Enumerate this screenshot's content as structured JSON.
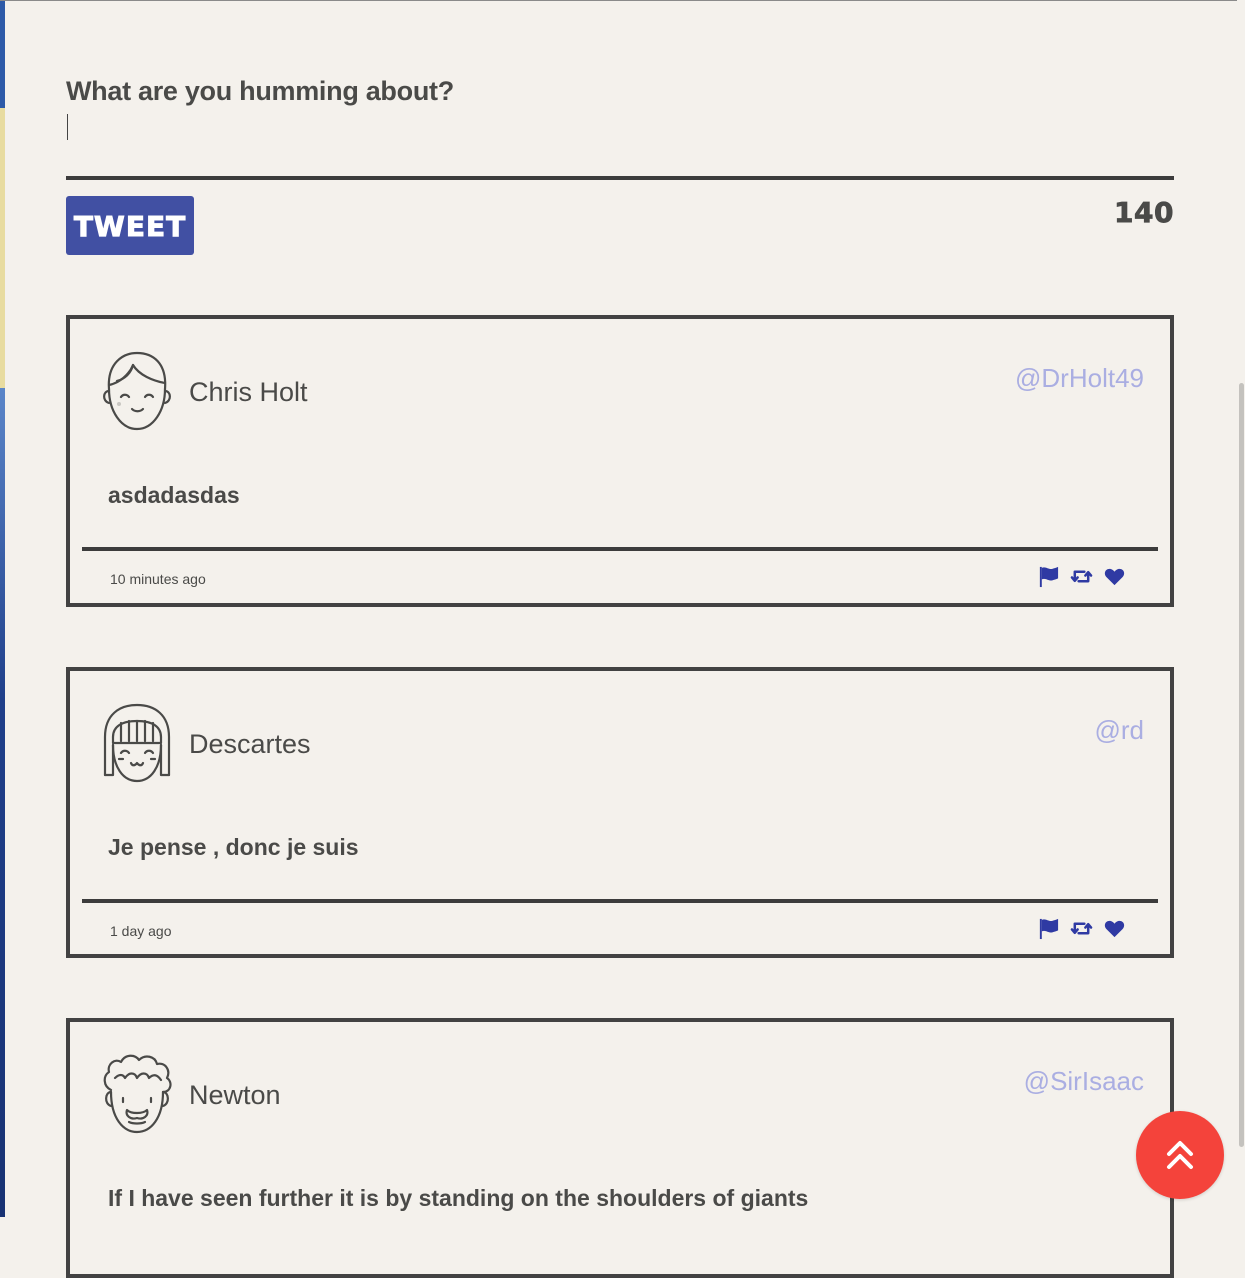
{
  "composer": {
    "label": "What are you humming about?",
    "input_value": "",
    "tweet_button_label": "TWEET",
    "char_count": "140"
  },
  "tweets": [
    {
      "name": "Chris Holt",
      "handle": "@DrHolt49",
      "body": "asdadasdas",
      "time": "10 minutes ago",
      "avatar": "boy-face-icon"
    },
    {
      "name": "Descartes",
      "handle": "@rd",
      "body": "Je pense , donc je suis",
      "time": "1 day ago",
      "avatar": "girl-bangs-face-icon"
    },
    {
      "name": "Newton",
      "handle": "@SirIsaac",
      "body": "If I have seen further it is by standing on the shoulders of giants",
      "time": "",
      "avatar": "curly-hair-face-icon"
    }
  ],
  "icons": {
    "flag": "flag-icon",
    "retweet": "retweet-icon",
    "like": "heart-icon",
    "scroll_top": "double-chevron-up-icon"
  },
  "colors": {
    "background": "#f4f1ec",
    "accent": "#4150a3",
    "handle": "#aaaee2",
    "action_icons": "#2f3aa3",
    "scroll_top_button": "#f4433b",
    "border": "#424242"
  }
}
